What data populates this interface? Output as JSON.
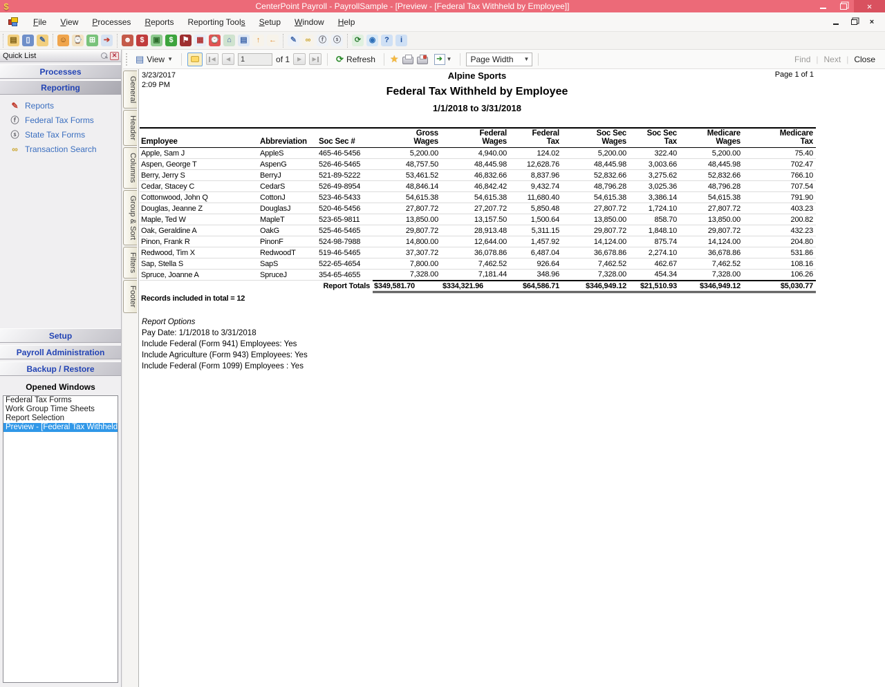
{
  "window": {
    "title": "CenterPoint Payroll - PayrollSample - [Preview - [Federal Tax Withheld by Employee]]",
    "titlebar_color": "#ec6a78",
    "close_button_color": "#d9515f",
    "app_icon_glyph": "$"
  },
  "menu_bar": {
    "items": [
      {
        "pre": "",
        "key": "F",
        "post": "ile"
      },
      {
        "pre": "",
        "key": "V",
        "post": "iew"
      },
      {
        "pre": "",
        "key": "P",
        "post": "rocesses"
      },
      {
        "pre": "",
        "key": "R",
        "post": "eports"
      },
      {
        "pre": "Reporting Tool",
        "key": "s",
        "post": ""
      },
      {
        "pre": "",
        "key": "S",
        "post": "etup"
      },
      {
        "pre": "",
        "key": "W",
        "post": "indow"
      },
      {
        "pre": "",
        "key": "H",
        "post": "elp"
      }
    ]
  },
  "toolbar": {
    "group1": [
      {
        "name": "open-icon",
        "glyph": "▤",
        "fg": "#7a5c13",
        "bg": "#f2cf7e"
      },
      {
        "name": "exit-icon",
        "glyph": "▯",
        "fg": "#ffffff",
        "bg": "#6f8fc9"
      },
      {
        "name": "folder-edit-icon",
        "glyph": "✎",
        "fg": "#355f9e",
        "bg": "#f2cf7e"
      }
    ],
    "group2": [
      {
        "name": "employees-icon",
        "glyph": "☺",
        "fg": "#7a4a10",
        "bg": "#f0a54c"
      },
      {
        "name": "time-clock-icon",
        "glyph": "⌚",
        "fg": "#6b4a1a",
        "bg": "#f3e3c3"
      },
      {
        "name": "timesheets-icon",
        "glyph": "⊞",
        "fg": "#ffffff",
        "bg": "#79c27a"
      },
      {
        "name": "web-employee-icon",
        "glyph": "➔",
        "fg": "#c23b2e",
        "bg": "#d7e3f2"
      }
    ],
    "group3": [
      {
        "name": "employee-maintenance-icon",
        "glyph": "☻",
        "fg": "#ffffff",
        "bg": "#c45a49"
      },
      {
        "name": "pay-employees-icon",
        "glyph": "$",
        "fg": "#ffffff",
        "bg": "#c03c3c"
      },
      {
        "name": "process-payroll-icon",
        "glyph": "▣",
        "fg": "#2e6e2e",
        "bg": "#8fcb8f"
      },
      {
        "name": "payments-icon",
        "glyph": "$",
        "fg": "#ffffff",
        "bg": "#3da43d"
      },
      {
        "name": "journal-icon",
        "glyph": "⚑",
        "fg": "#ffffff",
        "bg": "#9e2f2f"
      },
      {
        "name": "calendar-icon",
        "glyph": "▦",
        "fg": "#b03030",
        "bg": "#e8eef8"
      },
      {
        "name": "reminders-icon",
        "glyph": "⌚",
        "fg": "#ffffff",
        "bg": "#e25555"
      },
      {
        "name": "home-icon",
        "glyph": "⌂",
        "fg": "#3e5fa3",
        "bg": "#cfe3cf"
      },
      {
        "name": "item-list-icon",
        "glyph": "▤",
        "fg": "#3a62a8",
        "bg": "#dfe8f5"
      },
      {
        "name": "arrow-up-icon",
        "glyph": "↑",
        "fg": "#e08a2e",
        "bg": "#f7f3ea"
      },
      {
        "name": "arrow-back-icon",
        "glyph": "←",
        "fg": "#e08a2e",
        "bg": "#f7f3ea"
      }
    ],
    "group4": [
      {
        "name": "report-designer-icon",
        "glyph": "✎",
        "fg": "#4a6fae",
        "bg": "#eef2f8"
      },
      {
        "name": "binoculars-icon",
        "glyph": "∞",
        "fg": "#c9a227",
        "bg": "#f7f3ea"
      },
      {
        "name": "federal-coins-icon",
        "glyph": "ⓕ",
        "fg": "#6d6d74",
        "bg": "#eef2f8"
      },
      {
        "name": "state-coins-icon",
        "glyph": "ⓢ",
        "fg": "#6d6d74",
        "bg": "#eef2f8"
      }
    ],
    "group5": [
      {
        "name": "web-sync-icon",
        "glyph": "⟳",
        "fg": "#2e7d32",
        "bg": "#dff0df"
      },
      {
        "name": "globe-icon",
        "glyph": "◉",
        "fg": "#2d6fb8",
        "bg": "#d7e8f7"
      },
      {
        "name": "help-icon",
        "glyph": "?",
        "fg": "#1d4f9e",
        "bg": "#cfe0f5"
      },
      {
        "name": "info-icon",
        "glyph": "i",
        "fg": "#1d4f9e",
        "bg": "#cfe0f5"
      }
    ]
  },
  "quick_list": {
    "title": "Quick List",
    "top_sections": [
      {
        "label": "Processes",
        "selected": false
      },
      {
        "label": "Reporting",
        "selected": true
      }
    ],
    "items": [
      {
        "label": "Reports",
        "icon_name": "reports-icon",
        "icon_glyph": "✎",
        "icon_fg": "#c0392b"
      },
      {
        "label": "Federal Tax Forms",
        "icon_name": "federal-tax-forms-icon",
        "icon_glyph": "ⓕ",
        "icon_fg": "#6d6d74"
      },
      {
        "label": "State Tax Forms",
        "icon_name": "state-tax-forms-icon",
        "icon_glyph": "ⓢ",
        "icon_fg": "#6d6d74"
      },
      {
        "label": "Transaction Search",
        "icon_name": "transaction-search-icon",
        "icon_glyph": "∞",
        "icon_fg": "#c9a227"
      }
    ],
    "bottom_sections": [
      {
        "label": "Setup",
        "selected": false
      },
      {
        "label": "Payroll Administration",
        "selected": false
      },
      {
        "label": "Backup / Restore",
        "selected": false
      }
    ],
    "opened_windows_label": "Opened Windows",
    "opened_windows": [
      {
        "label": "Federal Tax Forms",
        "selected": false
      },
      {
        "label": "Work Group Time Sheets",
        "selected": false
      },
      {
        "label": "Report Selection",
        "selected": false
      },
      {
        "label": "Preview - [Federal Tax Withheld b",
        "selected": true
      }
    ],
    "selection_color": "#2f97e8"
  },
  "preview_toolbar": {
    "view_label": "View",
    "page_input": "1",
    "of_label": "of 1",
    "refresh_label": "Refresh",
    "zoom_value": "Page Width",
    "find_label": "Find",
    "next_label": "Next",
    "close_label": "Close",
    "nav": {
      "first": "◀",
      "prev": "◀",
      "next": "▶",
      "last": "▶"
    }
  },
  "side_tabs": [
    {
      "label": "General"
    },
    {
      "label": "Header"
    },
    {
      "label": "Columns"
    },
    {
      "label": "Group & Sort"
    },
    {
      "label": "Filters"
    },
    {
      "label": "Footer"
    }
  ],
  "report": {
    "header": {
      "date": "3/23/2017",
      "time": "2:09 PM",
      "company": "Alpine Sports",
      "title": "Federal Tax Withheld by Employee",
      "range": "1/1/2018 to 3/31/2018",
      "page": "Page 1 of 1"
    },
    "table": {
      "columns": [
        {
          "l1": "",
          "l2": "Employee"
        },
        {
          "l1": "",
          "l2": "Abbreviation"
        },
        {
          "l1": "",
          "l2": "Soc Sec #"
        },
        {
          "l1": "Gross",
          "l2": "Wages"
        },
        {
          "l1": "Federal",
          "l2": "Wages"
        },
        {
          "l1": "Federal",
          "l2": "Tax"
        },
        {
          "l1": "Soc Sec",
          "l2": "Wages"
        },
        {
          "l1": "Soc Sec",
          "l2": "Tax"
        },
        {
          "l1": "Medicare",
          "l2": "Wages"
        },
        {
          "l1": "Medicare",
          "l2": "Tax"
        }
      ],
      "rows": [
        [
          "Apple, Sam J",
          "AppleS",
          "465-46-5456",
          "5,200.00",
          "4,940.00",
          "124.02",
          "5,200.00",
          "322.40",
          "5,200.00",
          "75.40"
        ],
        [
          "Aspen, George T",
          "AspenG",
          "526-46-5465",
          "48,757.50",
          "48,445.98",
          "12,628.76",
          "48,445.98",
          "3,003.66",
          "48,445.98",
          "702.47"
        ],
        [
          "Berry, Jerry S",
          "BerryJ",
          "521-89-5222",
          "53,461.52",
          "46,832.66",
          "8,837.96",
          "52,832.66",
          "3,275.62",
          "52,832.66",
          "766.10"
        ],
        [
          "Cedar, Stacey C",
          "CedarS",
          "526-49-8954",
          "48,846.14",
          "46,842.42",
          "9,432.74",
          "48,796.28",
          "3,025.36",
          "48,796.28",
          "707.54"
        ],
        [
          "Cottonwood, John Q",
          "CottonJ",
          "523-46-5433",
          "54,615.38",
          "54,615.38",
          "11,680.40",
          "54,615.38",
          "3,386.14",
          "54,615.38",
          "791.90"
        ],
        [
          "Douglas, Jeanne Z",
          "DouglasJ",
          "520-46-5456",
          "27,807.72",
          "27,207.72",
          "5,850.48",
          "27,807.72",
          "1,724.10",
          "27,807.72",
          "403.23"
        ],
        [
          "Maple, Ted W",
          "MapleT",
          "523-65-9811",
          "13,850.00",
          "13,157.50",
          "1,500.64",
          "13,850.00",
          "858.70",
          "13,850.00",
          "200.82"
        ],
        [
          "Oak, Geraldine A",
          "OakG",
          "525-46-5465",
          "29,807.72",
          "28,913.48",
          "5,311.15",
          "29,807.72",
          "1,848.10",
          "29,807.72",
          "432.23"
        ],
        [
          "Pinon, Frank R",
          "PinonF",
          "524-98-7988",
          "14,800.00",
          "12,644.00",
          "1,457.92",
          "14,124.00",
          "875.74",
          "14,124.00",
          "204.80"
        ],
        [
          "Redwood, Tim X",
          "RedwoodT",
          "519-46-5465",
          "37,307.72",
          "36,078.86",
          "6,487.04",
          "36,678.86",
          "2,274.10",
          "36,678.86",
          "531.86"
        ],
        [
          "Sap, Stella S",
          "SapS",
          "522-65-4654",
          "7,800.00",
          "7,462.52",
          "926.64",
          "7,462.52",
          "462.67",
          "7,462.52",
          "108.16"
        ],
        [
          "Spruce, Joanne A",
          "SpruceJ",
          "354-65-4655",
          "7,328.00",
          "7,181.44",
          "348.96",
          "7,328.00",
          "454.34",
          "7,328.00",
          "106.26"
        ]
      ],
      "totals_label": "Report Totals",
      "totals": [
        "$349,581.70",
        "$334,321.96",
        "$64,586.71",
        "$346,949.12",
        "$21,510.93",
        "$346,949.12",
        "$5,030.77"
      ],
      "records_note": "Records included in total = 12"
    },
    "options": {
      "title": "Report Options",
      "lines": [
        "Pay Date: 1/1/2018 to 3/31/2018",
        "Include Federal (Form 941) Employees: Yes",
        "Include Agriculture (Form 943) Employees: Yes",
        "Include Federal (Form 1099) Employees : Yes"
      ]
    }
  }
}
